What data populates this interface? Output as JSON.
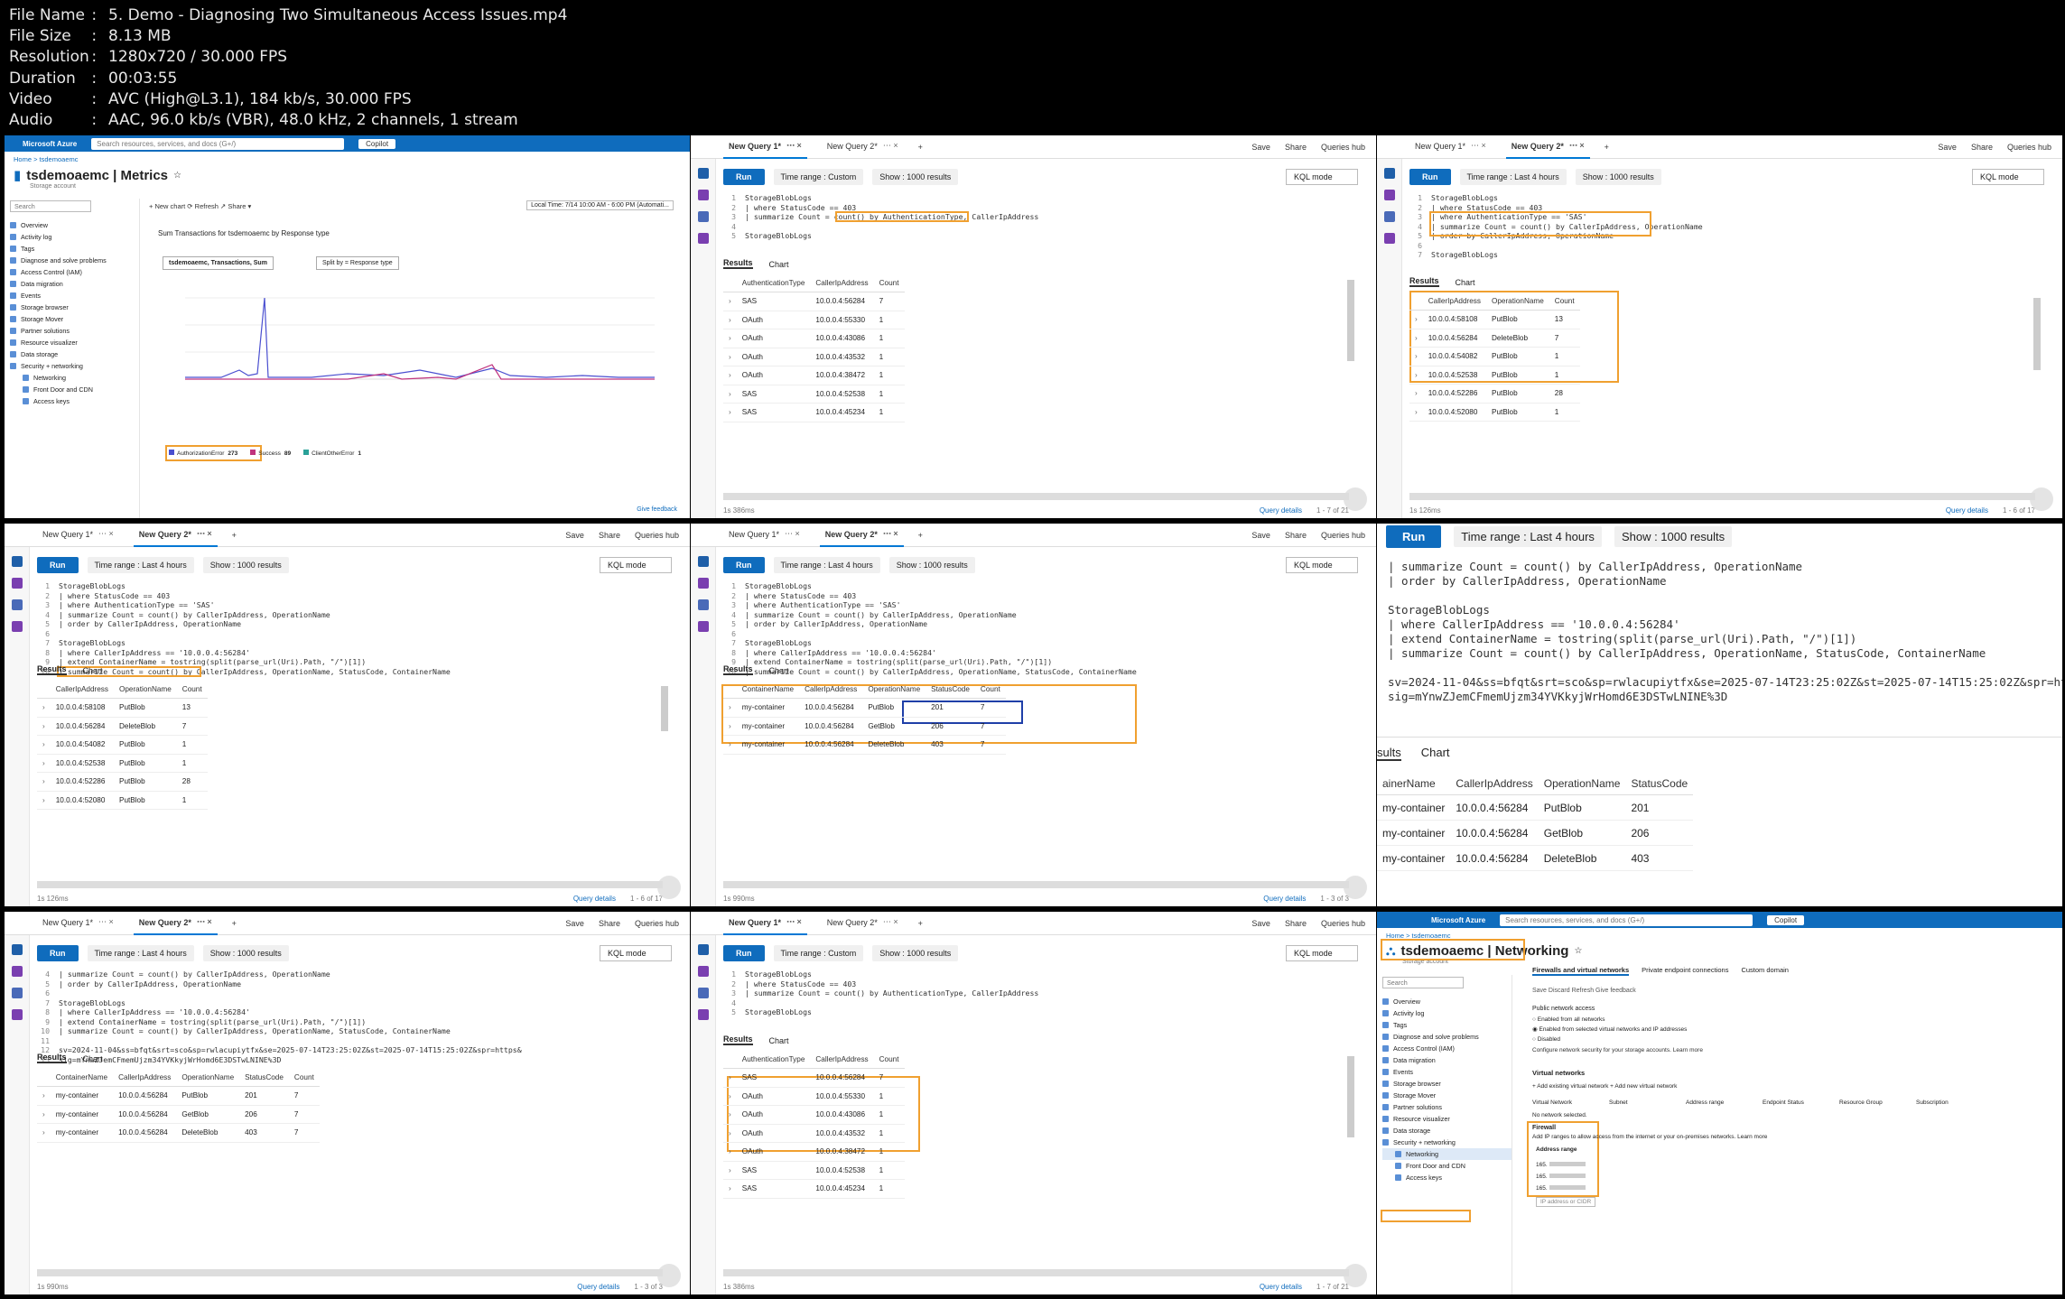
{
  "info": {
    "rows": [
      {
        "k": "File Name",
        "v": "5. Demo - Diagnosing Two Simultaneous Access Issues.mp4"
      },
      {
        "k": "File Size",
        "v": "8.13 MB"
      },
      {
        "k": "Resolution",
        "v": "1280x720 / 30.000 FPS"
      },
      {
        "k": "Duration",
        "v": "00:03:55"
      },
      {
        "k": "Video",
        "v": "AVC (High@L3.1), 184 kb/s, 30.000 FPS"
      },
      {
        "k": "Audio",
        "v": "AAC, 96.0 kb/s (VBR), 48.0 kHz, 2 channels, 1 stream"
      }
    ]
  },
  "common": {
    "tab1": "New Query 1*",
    "tab2": "New Query 2*",
    "save": "Save",
    "share": "Share",
    "hub": "Queries hub",
    "run": "Run",
    "custom": "Time range : Custom",
    "last4": "Time range : Last 4 hours",
    "show": "Show : 1000 results",
    "kql": "KQL mode",
    "results": "Results",
    "chart": "Chart",
    "query_details": "Query details"
  },
  "p1": {
    "topbar": "Microsoft Azure",
    "search": "Search resources, services, and docs (G+/)",
    "copilot": "Copilot",
    "crumb": "Home > tsdemoaemc",
    "title": "tsdemoaemc | Metrics",
    "sub": "Storage account",
    "toolbar": "+ New chart   ⟳ Refresh   ↗ Share ▾",
    "localtime": "Local Time: 7/14 10:00 AM - 6:00 PM (Automati...",
    "chart_title": "Sum Transactions for tsdemoaemc by Response type",
    "chips": "tsdemoaemc, Transactions, Sum",
    "split": "Split by = Response type",
    "legend": [
      {
        "name": "AuthorizationError",
        "val": "273"
      },
      {
        "name": "Success",
        "val": "89"
      },
      {
        "name": "ClientOtherError",
        "val": "1"
      }
    ],
    "nav": [
      "Overview",
      "Activity log",
      "Tags",
      "Diagnose and solve problems",
      "Access Control (IAM)",
      "Data migration",
      "Events",
      "Storage browser",
      "Storage Mover",
      "Partner solutions",
      "Resource visualizer",
      "Data storage",
      "Security + networking",
      "Networking",
      "Front Door and CDN",
      "Access keys"
    ],
    "feedback": "Give feedback"
  },
  "p2": {
    "code": [
      "StorageBlobLogs",
      "| where StatusCode == 403",
      "| summarize Count = count() by AuthenticationType, CallerIpAddress",
      "",
      "StorageBlobLogs"
    ],
    "cols": [
      "AuthenticationType",
      "CallerIpAddress",
      "Count"
    ],
    "rows": [
      [
        "SAS",
        "10.0.0.4:56284",
        "7"
      ],
      [
        "OAuth",
        "10.0.0.4:55330",
        "1"
      ],
      [
        "OAuth",
        "10.0.0.4:43086",
        "1"
      ],
      [
        "OAuth",
        "10.0.0.4:43532",
        "1"
      ],
      [
        "OAuth",
        "10.0.0.4:38472",
        "1"
      ],
      [
        "SAS",
        "10.0.0.4:52538",
        "1"
      ],
      [
        "SAS",
        "10.0.0.4:45234",
        "1"
      ]
    ],
    "time": "1s 386ms",
    "count": "1 - 7 of 21"
  },
  "p3": {
    "code": [
      "StorageBlobLogs",
      "| where StatusCode == 403",
      "| where AuthenticationType == 'SAS'",
      "| summarize Count = count() by CallerIpAddress, OperationName",
      "| order by CallerIpAddress, OperationName",
      "",
      "StorageBlobLogs"
    ],
    "cols": [
      "CallerIpAddress",
      "OperationName",
      "Count"
    ],
    "rows": [
      [
        "10.0.0.4:58108",
        "PutBlob",
        "13"
      ],
      [
        "10.0.0.4:56284",
        "DeleteBlob",
        "7"
      ],
      [
        "10.0.0.4:54082",
        "PutBlob",
        "1"
      ],
      [
        "10.0.0.4:52538",
        "PutBlob",
        "1"
      ],
      [
        "10.0.0.4:52286",
        "PutBlob",
        "28"
      ],
      [
        "10.0.0.4:52080",
        "PutBlob",
        "1"
      ]
    ],
    "time": "1s 126ms",
    "count": "1 - 6 of 17"
  },
  "p4": {
    "code": [
      "StorageBlobLogs",
      "| where StatusCode == 403",
      "| where AuthenticationType == 'SAS'",
      "| summarize Count = count() by CallerIpAddress, OperationName",
      "| order by CallerIpAddress, OperationName",
      "",
      "StorageBlobLogs",
      "| where CallerIpAddress == '10.0.0.4:56284'",
      "| extend ContainerName = tostring(split(parse_url(Uri).Path, \"/\")[1])",
      "| summarize Count = count() by CallerIpAddress, OperationName, StatusCode, ContainerName"
    ],
    "time": "1s 126ms",
    "count": "1 - 6 of 17"
  },
  "p5": {
    "cols": [
      "ContainerName",
      "CallerIpAddress",
      "OperationName",
      "StatusCode",
      "Count"
    ],
    "rows": [
      [
        "my-container",
        "10.0.0.4:56284",
        "PutBlob",
        "201",
        "7"
      ],
      [
        "my-container",
        "10.0.0.4:56284",
        "GetBlob",
        "206",
        "7"
      ],
      [
        "my-container",
        "10.0.0.4:56284",
        "DeleteBlob",
        "403",
        "7"
      ]
    ],
    "time": "1s 990ms",
    "count": "1 - 3 of 3"
  },
  "p6": {
    "code": [
      "| summarize Count = count() by CallerIpAddress, OperationName",
      "| order by CallerIpAddress, OperationName",
      "",
      "StorageBlobLogs",
      "| where CallerIpAddress == '10.0.0.4:56284'",
      "| extend ContainerName = tostring(split(parse_url(Uri).Path, \"/\")[1])",
      "| summarize Count = count() by CallerIpAddress, OperationName, StatusCode, ContainerName",
      "",
      "sv=2024-11-04&ss=bfqt&srt=sco&sp=rwlacupiytfx&se=2025-07-14T23:25:02Z&st=2025-07-14T15:25:02Z&spr=https&",
      "sig=mYnwZJemCFmemUjzm34YVKkyjWrHomd6E3DSTwLNINE%3D"
    ],
    "results_cut": "sults",
    "cols": [
      "ainerName",
      "CallerIpAddress",
      "OperationName",
      "StatusCode"
    ],
    "rows": [
      [
        "my-container",
        "10.0.0.4:56284",
        "PutBlob",
        "201"
      ],
      [
        "my-container",
        "10.0.0.4:56284",
        "GetBlob",
        "206"
      ],
      [
        "my-container",
        "10.0.0.4:56284",
        "DeleteBlob",
        "403"
      ]
    ]
  },
  "p7": {
    "code": [
      "| summarize Count = count() by CallerIpAddress, OperationName",
      "| order by CallerIpAddress, OperationName",
      "",
      "StorageBlobLogs",
      "| where CallerIpAddress == '10.0.0.4:56284'",
      "| extend ContainerName = tostring(split(parse_url(Uri).Path, \"/\")[1])",
      "| summarize Count = count() by CallerIpAddress, OperationName, StatusCode, ContainerName",
      "",
      "sv=2024-11-04&ss=bfqt&srt=sco&sp=rwlacupiytfx&se=2025-07-14T23:25:02Z&st=2025-07-14T15:25:02Z&spr=https&",
      "sig=mYnwZJemCFmemUjzm34YVKkyjWrHomd6E3DSTwLNINE%3D"
    ],
    "time": "1s 990ms",
    "count": "1 - 3 of 3"
  },
  "p9": {
    "title": "tsdemoaemc | Networking",
    "tabs": [
      "Firewalls and virtual networks",
      "Private endpoint connections",
      "Custom domain"
    ],
    "tools": "Save   Discard   Refresh   Give feedback",
    "pna": "Public network access",
    "opts": [
      "Enabled from all networks",
      "Enabled from selected virtual networks and IP addresses",
      "Disabled"
    ],
    "note": "Configure network security for your storage accounts. Learn more",
    "vn": "Virtual networks",
    "addvn": "+ Add existing virtual network   + Add new virtual network",
    "vncols": [
      "Virtual Network",
      "Subnet",
      "Address range",
      "Endpoint Status",
      "Resource Group",
      "Subscription"
    ],
    "novn": "No network selected.",
    "fw": "Firewall",
    "fwdesc": "Add IP ranges to allow access from the internet or your on-premises networks. Learn more",
    "addr": "Address range",
    "ips": [
      "165.",
      "165.",
      "165."
    ],
    "ipcidr": "IP address or CIDR"
  }
}
